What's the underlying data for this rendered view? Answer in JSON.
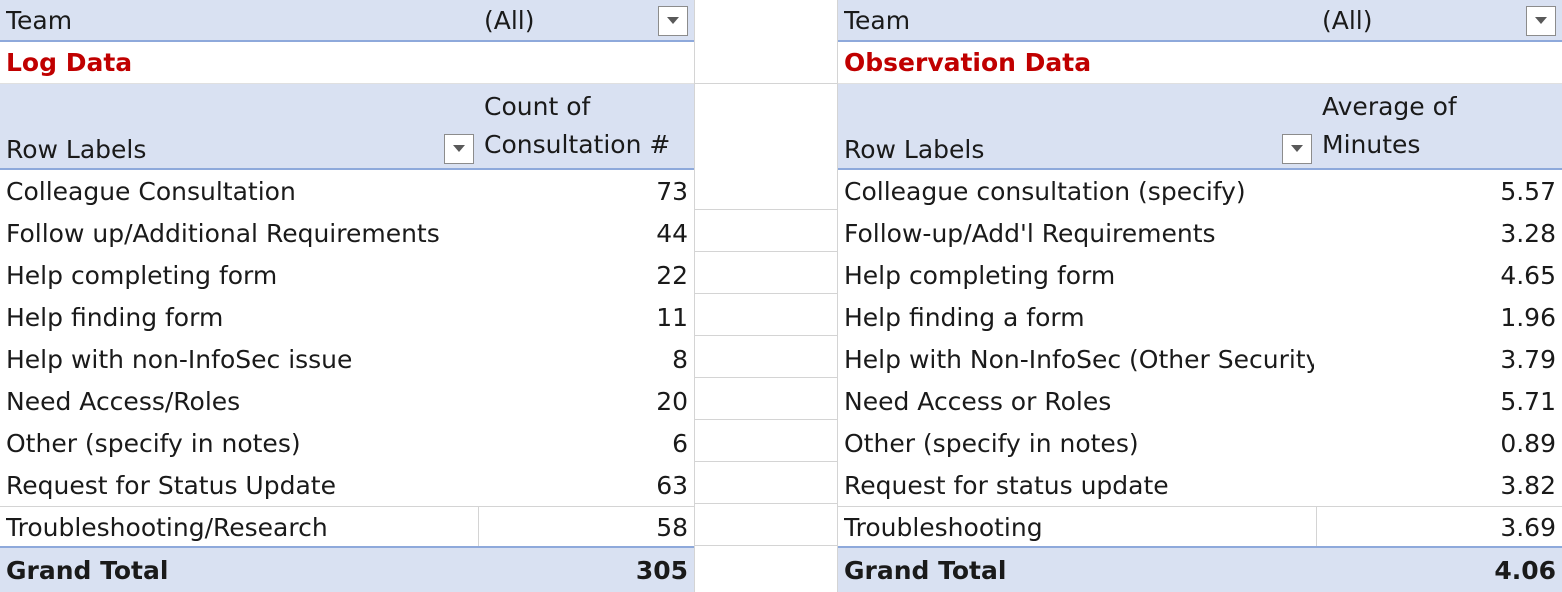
{
  "left": {
    "filter_label": "Team",
    "filter_value": "(All)",
    "title": "Log Data",
    "header_row_label": "Row Labels",
    "header_value_line1": "Count of",
    "header_value_line2": "Consultation #",
    "rows": [
      {
        "label": "Colleague Consultation",
        "value": "73"
      },
      {
        "label": "Follow up/Additional Requirements",
        "value": "44"
      },
      {
        "label": "Help completing form",
        "value": "22"
      },
      {
        "label": "Help finding form",
        "value": "11"
      },
      {
        "label": "Help with non-InfoSec issue",
        "value": "8"
      },
      {
        "label": "Need Access/Roles",
        "value": "20"
      },
      {
        "label": "Other (specify in notes)",
        "value": "6"
      },
      {
        "label": "Request for Status Update",
        "value": "63"
      },
      {
        "label": "Troubleshooting/Research",
        "value": "58"
      }
    ],
    "total_label": "Grand Total",
    "total_value": "305"
  },
  "right": {
    "filter_label": "Team",
    "filter_value": "(All)",
    "title": "Observation Data",
    "header_row_label": "Row Labels",
    "header_value_line1": "Average of",
    "header_value_line2": "Minutes",
    "rows": [
      {
        "label": "Colleague consultation (specify)",
        "value": "5.57"
      },
      {
        "label": "Follow-up/Add'l Requirements",
        "value": "3.28"
      },
      {
        "label": "Help completing form",
        "value": "4.65"
      },
      {
        "label": "Help finding a form",
        "value": "1.96"
      },
      {
        "label": "Help with Non-InfoSec (Other Security",
        "value": "3.79"
      },
      {
        "label": "Need Access or Roles",
        "value": "5.71"
      },
      {
        "label": "Other (specify in notes)",
        "value": "0.89"
      },
      {
        "label": "Request for status update",
        "value": "3.82"
      },
      {
        "label": "Troubleshooting",
        "value": "3.69"
      }
    ],
    "total_label": "Grand Total",
    "total_value": "4.06"
  },
  "colors": {
    "header_fill": "#d9e1f2",
    "header_border": "#8ea9db",
    "title_text": "#c00000"
  },
  "icons": {
    "dropdown": "chevron-down-icon"
  }
}
